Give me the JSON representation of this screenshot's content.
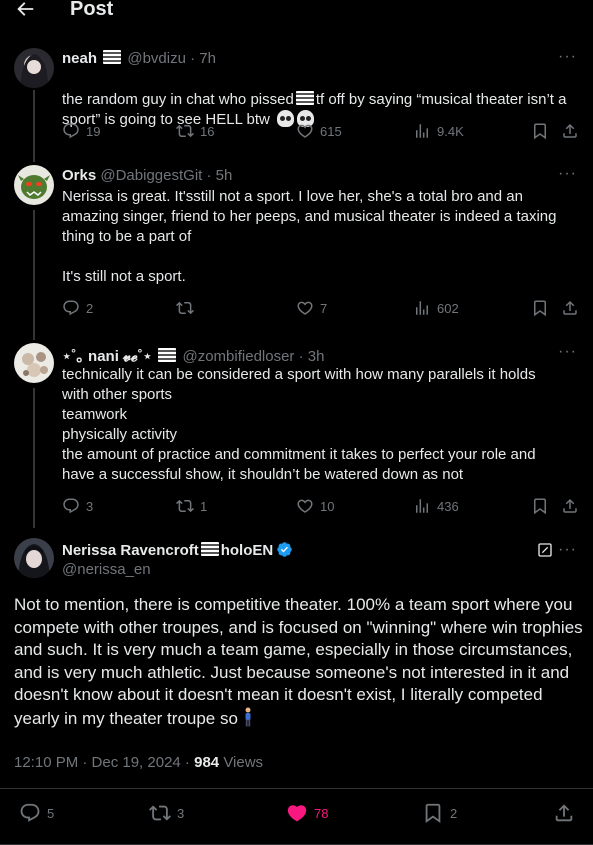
{
  "header": {
    "title": "Post"
  },
  "replies": [
    {
      "name": "neah",
      "handle": "@bvdizu",
      "time": "· 7h",
      "text_a": "the random guy in chat who pissed",
      "text_b": "tf off by saying “musical theater isn’t a sport” is going to see HELL btw",
      "replies": "19",
      "reposts": "16",
      "likes": "615",
      "views": "9.4K"
    },
    {
      "name": "Orks",
      "handle": "@DabiggestGit",
      "time": "· 5h",
      "text": "Nerissa is great. It'sstill not a sport. I love her, she's a total bro and an amazing singer, friend to her peeps, and musical theater is indeed a taxing thing to be a part of\n\nIt's still not a sport.",
      "replies": "2",
      "reposts": "",
      "likes": "7",
      "views": "602"
    },
    {
      "name": "⋆˚｡ nani 𝓿𝓮˚⋆",
      "handle": "@zombifiedloser",
      "time": "· 3h",
      "text": "technically it can be considered a sport with how many parallels it holds\nwith other sports\nteamwork\nphysically activity\nthe amount of practice and commitment it takes to perfect your role and\nhave a successful show, it shouldn’t be watered down as not",
      "replies": "3",
      "reposts": "1",
      "likes": "10",
      "views": "436"
    }
  ],
  "main": {
    "name": "Nerissa Ravencroft",
    "name_suffix": "holoEN",
    "handle": "@nerissa_en",
    "text": "Not to mention, there is competitive theater. 100% a team sport where you compete with other troupes, and is focused on \"winning\" where win trophies and such. It is very much a team game, especially in those circumstances, and is very much athletic. Just because someone's not interested in it and doesn't know about it doesn't mean it doesn't exist, I literally competed yearly in my theater troupe so",
    "time": "12:10 PM · Dec 19, 2024 ·",
    "views_count": "984",
    "views_label": "Views",
    "replies": "5",
    "reposts": "3",
    "likes": "78",
    "bookmarks": "2"
  },
  "colors": {
    "like_active": "#f91880",
    "verified": "#1d9bf0",
    "muted": "#71767b"
  }
}
